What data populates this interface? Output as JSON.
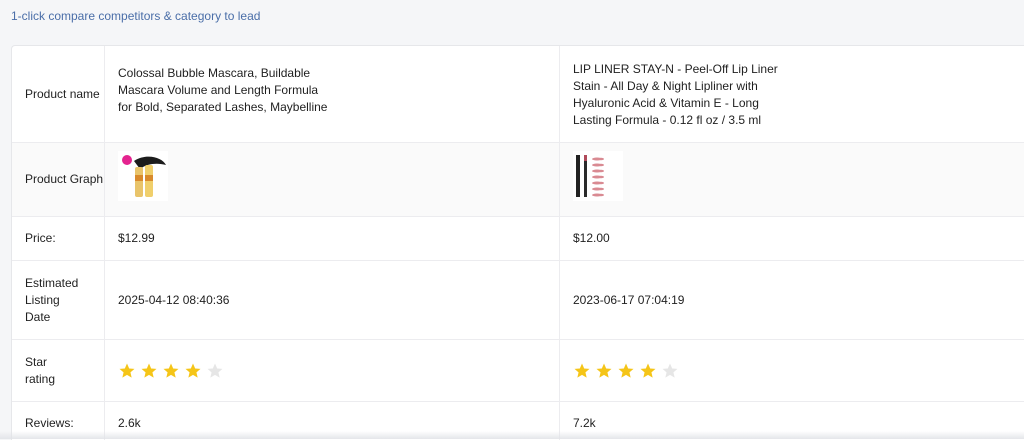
{
  "header": {
    "link_text": "1-click compare competitors & category to lead"
  },
  "table": {
    "labels": {
      "product_name": "Product name",
      "product_graph": "Product Graph",
      "price": "Price:",
      "listing_date": "Estimated Listing Date",
      "star_rating": "Star rating",
      "reviews": "Reviews:"
    },
    "products": [
      {
        "name": "Colossal Bubble Mascara, Buildable Mascara Volume and Length Formula for Bold, Separated Lashes, Maybelline",
        "image_icon": "mascara-product-thumbnail",
        "price": "$12.99",
        "listing_date": "2025-04-12 08:40:36",
        "rating_stars": 4,
        "reviews": "2.6k"
      },
      {
        "name": "LIP LINER STAY-N - Peel-Off Lip Liner Stain - All Day & Night Lipliner with Hyaluronic Acid & Vitamin E - Long Lasting Formula - 0.12 fl oz / 3.5 ml",
        "image_icon": "lip-liner-product-thumbnail",
        "price": "$12.00",
        "listing_date": "2023-06-17 07:04:19",
        "rating_stars": 4,
        "reviews": "7.2k"
      }
    ]
  },
  "colors": {
    "star_filled": "#f5c518",
    "star_empty": "#e6e6e6",
    "link": "#4a6ea8"
  }
}
